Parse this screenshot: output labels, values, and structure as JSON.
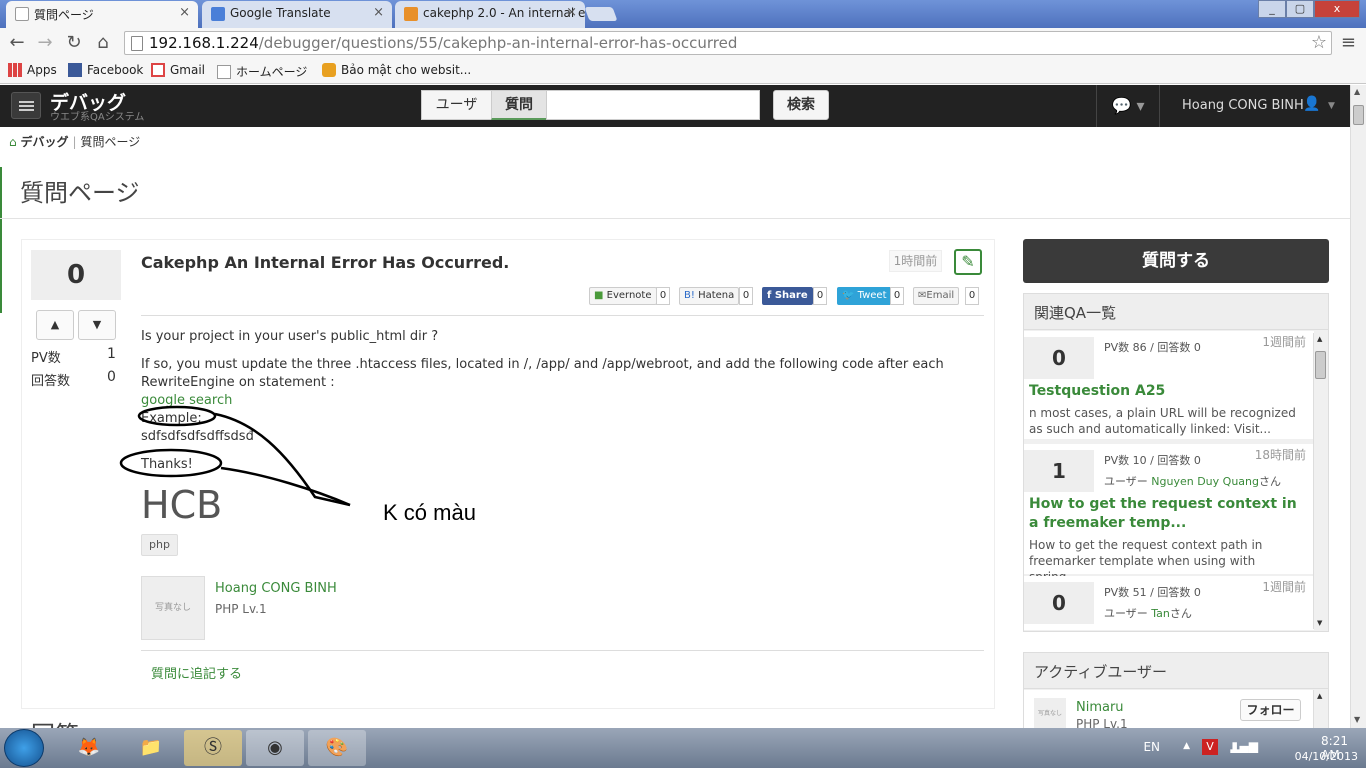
{
  "browser": {
    "tabs": [
      {
        "title": "質問ページ",
        "active": true
      },
      {
        "title": "Google Translate",
        "active": false
      },
      {
        "title": "cakephp 2.0 - An internal e",
        "active": false
      }
    ],
    "url_host": "192.168.1.224",
    "url_path": "/debugger/questions/55/cakephp-an-internal-error-has-occurred",
    "bookmarks": [
      "Apps",
      "Facebook",
      "Gmail",
      "ホームページ",
      "Bảo mật cho websit..."
    ],
    "window_controls": [
      "_",
      "▢",
      "x"
    ]
  },
  "app": {
    "brand": "デバッグ",
    "brand_sub": "ウエブ系QAシステム",
    "search_tabs": [
      "ユーザ",
      "質問"
    ],
    "search_button": "検索",
    "search_value": "",
    "user_name": "Hoang CONG BINH"
  },
  "breadcrumb": {
    "home": "デバッグ",
    "current": "質問ページ"
  },
  "page_title": "質問ページ",
  "question": {
    "votes": "0",
    "pv_label": "PV数",
    "pv_value": "1",
    "answers_label": "回答数",
    "answers_value": "0",
    "title": "Cakephp An Internal Error Has Occurred.",
    "time_ago": "1時間前",
    "share": [
      {
        "label": "Evernote",
        "count": "0"
      },
      {
        "label": "Hatena",
        "count": "0"
      },
      {
        "label": "Share",
        "count": "0"
      },
      {
        "label": "Tweet",
        "count": "0"
      },
      {
        "label": "Email",
        "count": "0"
      }
    ],
    "body_line1": "Is your project in your user's public_html dir ?",
    "body_line2": "If so, you must update the three .htaccess files, located in /, /app/ and /app/webroot, and add the following code after each RewriteEngine on statement :",
    "link_text": "google search",
    "example": "Example:",
    "example_text": "sdfsdfsdfsdffsdsđ",
    "thanks": "Thanks!",
    "big_text": "HCB",
    "tag": "php",
    "author_photo": "写真なし",
    "author": "Hoang CONG BINH",
    "author_level": "PHP Lv.1",
    "add_to_question": "質問に追記する",
    "annotation": "K có màu"
  },
  "answers_heading": "回答",
  "sidebar": {
    "ask_button": "質問する",
    "related_heading": "関連QA一覧",
    "related": [
      {
        "count": "0",
        "meta": "PV数 86 / 回答数 0",
        "ago": "1週間前",
        "user_prefix": "",
        "user": "",
        "user_suffix": "",
        "title": "Testquestion A25",
        "desc": "n most cases, a plain URL will be recognized as such and automatically linked: Visit..."
      },
      {
        "count": "1",
        "meta": "PV数 10 / 回答数 0",
        "ago": "18時間前",
        "user_prefix": "ユーザー",
        "user": "Nguyen Duy Quang",
        "user_suffix": "さん",
        "title": "How to get the request context in a freemaker temp...",
        "desc": "How to get the request context path in freemarker template when using with spring...."
      },
      {
        "count": "0",
        "meta": "PV数 51 / 回答数 0",
        "ago": "1週間前",
        "user_prefix": "ユーザー",
        "user": "Tan",
        "user_suffix": "さん",
        "title": "",
        "desc": ""
      }
    ],
    "active_heading": "アクティブユーザー",
    "active_users": [
      {
        "photo": "写真なし",
        "name": "Nimaru",
        "level": "PHP Lv.1",
        "follow": "フォロー"
      }
    ]
  },
  "taskbar": {
    "lang": "EN",
    "time": "8:21 AM",
    "date": "04/10/2013"
  },
  "colors": {
    "accent": "#3a8a3a",
    "navbar": "#222222",
    "ask": "#3a3a3a"
  }
}
